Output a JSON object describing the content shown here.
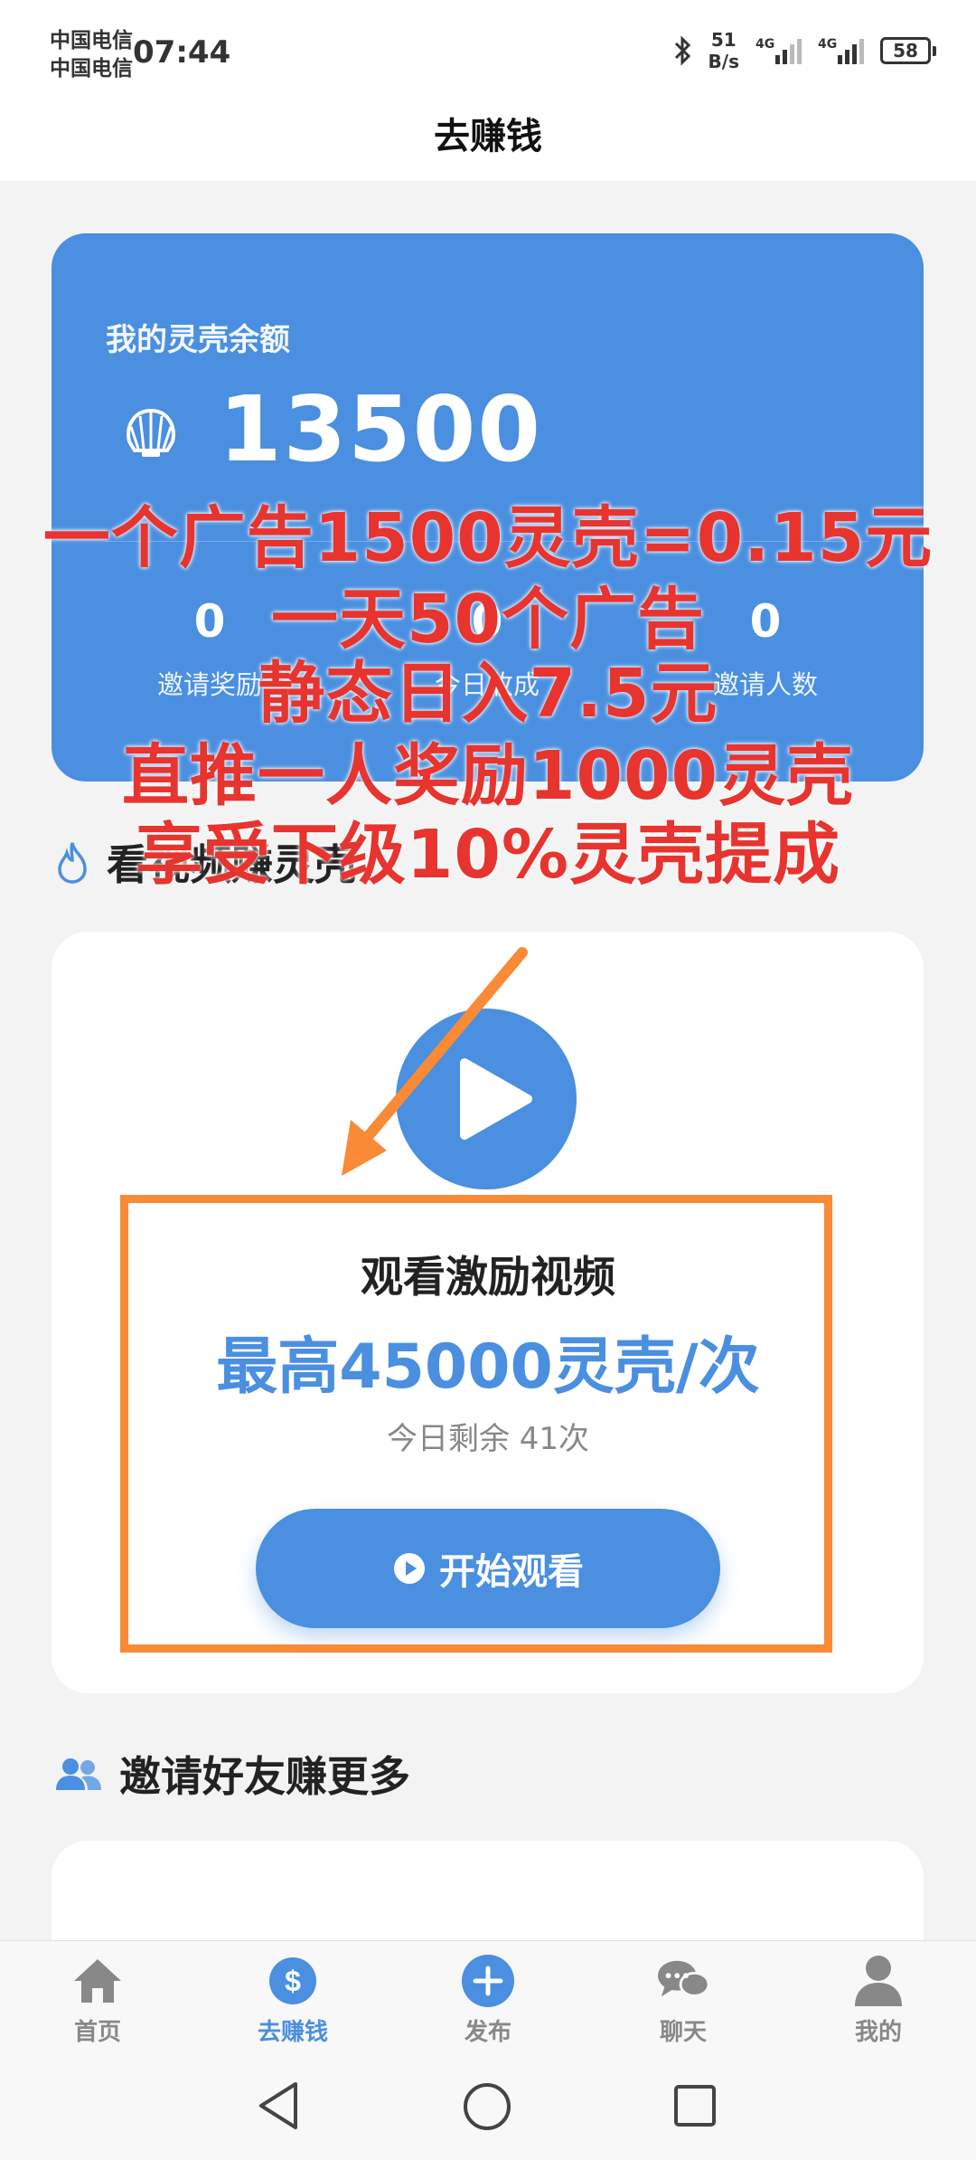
{
  "status_bar": {
    "carrier_1": "中国电信",
    "carrier_2": "中国电信",
    "time": "07:44",
    "speed_value": "51",
    "speed_unit": "B/s",
    "signal_1_tag": "4G",
    "signal_2_tag": "4G",
    "battery": "58"
  },
  "header": {
    "title": "去赚钱"
  },
  "balance_card": {
    "label": "我的灵壳余额",
    "value": "13500",
    "stats": [
      {
        "value": "0",
        "label": "邀请奖励"
      },
      {
        "value": "0",
        "label": "今日收成"
      },
      {
        "value": "0",
        "label": "邀请人数"
      }
    ]
  },
  "watch_section": {
    "title": "看视频赚灵壳"
  },
  "video_card": {
    "title": "观看激励视频",
    "reward": "最高45000灵壳/次",
    "remaining": "今日剩余 41次",
    "button_label": "开始观看"
  },
  "overlay_text": [
    "一个广告1500灵壳=0.15元",
    "一天50个广告",
    "静态日入7.5元",
    "直推一人奖励1000灵壳",
    "享受下级10%灵壳提成"
  ],
  "invite_section": {
    "title": "邀请好友赚更多"
  },
  "bottom_nav": [
    {
      "label": "首页",
      "icon": "home-icon"
    },
    {
      "label": "去赚钱",
      "icon": "dollar-icon"
    },
    {
      "label": "发布",
      "icon": "plus-icon"
    },
    {
      "label": "聊天",
      "icon": "chat-icon"
    },
    {
      "label": "我的",
      "icon": "person-icon"
    }
  ],
  "colors": {
    "accent": "#4a8fe0",
    "annotation_red": "#e8342e",
    "annotation_orange": "#f98a36"
  }
}
